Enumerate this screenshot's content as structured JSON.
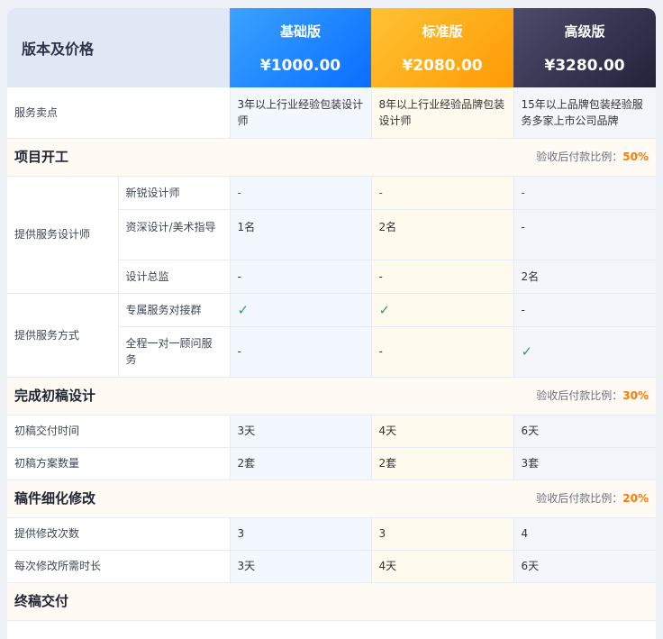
{
  "header": {
    "label": "版本及价格",
    "plans": [
      {
        "name": "基础版",
        "price": "¥1000.00"
      },
      {
        "name": "标准版",
        "price": "¥2080.00"
      },
      {
        "name": "高级版",
        "price": "¥3280.00"
      }
    ]
  },
  "selling": {
    "label": "服务卖点",
    "values": [
      "3年以上行业经验包装设计师",
      "8年以上行业经验品牌包装设计师",
      "15年以上品牌包装经验服务多家上市公司品牌"
    ]
  },
  "sections": {
    "s1": {
      "title": "项目开工",
      "ratio_label": "验收后付款比例：",
      "ratio": "50%"
    },
    "s2": {
      "title": "完成初稿设计",
      "ratio_label": "验收后付款比例：",
      "ratio": "30%"
    },
    "s3": {
      "title": "稿件细化修改",
      "ratio_label": "验收后付款比例：",
      "ratio": "20%"
    },
    "s4": {
      "title": "终稿交付"
    }
  },
  "designers": {
    "group": "提供服务设计师",
    "rows": [
      {
        "label": "新锐设计师",
        "values": [
          "-",
          "-",
          "-"
        ]
      },
      {
        "label": "资深设计/美术指导",
        "values": [
          "1名",
          "2名",
          "-"
        ]
      },
      {
        "label": "设计总监",
        "values": [
          "-",
          "-",
          "2名"
        ]
      }
    ]
  },
  "service": {
    "group": "提供服务方式",
    "rows": [
      {
        "label": "专属服务对接群",
        "values": [
          "✓",
          "✓",
          "-"
        ]
      },
      {
        "label": "全程一对一顾问服务",
        "values": [
          "-",
          "-",
          "✓"
        ]
      }
    ]
  },
  "draft": {
    "rows": [
      {
        "label": "初稿交付时间",
        "values": [
          "3天",
          "4天",
          "6天"
        ]
      },
      {
        "label": "初稿方案数量",
        "values": [
          "2套",
          "2套",
          "3套"
        ]
      }
    ]
  },
  "revise": {
    "rows": [
      {
        "label": "提供修改次数",
        "values": [
          "3",
          "3",
          "4"
        ]
      },
      {
        "label": "每次修改所需时长",
        "values": [
          "3天",
          "4天",
          "6天"
        ]
      }
    ]
  }
}
